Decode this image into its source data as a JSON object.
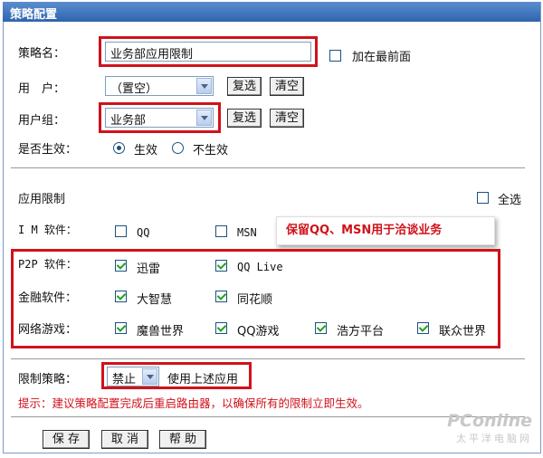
{
  "window": {
    "title": "策略配置"
  },
  "policy": {
    "name_label": "策略名：",
    "name_value": "业务部应用限制",
    "top_label": "加在最前面",
    "user_label": "用　户：",
    "user_value": "（置空）",
    "group_label": "用户组：",
    "group_value": "业务部",
    "multi_label": "复选",
    "clear_label": "清空",
    "effective_label": "是否生效：",
    "effective_on": "生效",
    "effective_off": "不生效"
  },
  "apps": {
    "section_label": "应用限制",
    "select_all": "全选",
    "note": "保留QQ、MSN用于洽谈业务",
    "rows": [
      {
        "label": "I M 软件：",
        "items": [
          {
            "label": "QQ",
            "checked": false
          },
          {
            "label": "MSN",
            "checked": false
          }
        ]
      },
      {
        "label": "P2P 软件：",
        "items": [
          {
            "label": "迅雷",
            "checked": true
          },
          {
            "label": "QQ Live",
            "checked": true
          }
        ]
      },
      {
        "label": "金融软件：",
        "items": [
          {
            "label": "大智慧",
            "checked": true
          },
          {
            "label": "同花顺",
            "checked": true
          }
        ]
      },
      {
        "label": "网络游戏：",
        "items": [
          {
            "label": "魔兽世界",
            "checked": true
          },
          {
            "label": "QQ游戏",
            "checked": true
          },
          {
            "label": "浩方平台",
            "checked": true
          },
          {
            "label": "联众世界",
            "checked": true
          }
        ]
      }
    ]
  },
  "limit": {
    "label": "限制策略：",
    "value": "禁止",
    "desc": "使用上述应用",
    "hint": "提示：建议策略配置完成后重启路由器，以确保所有的限制立即生效。"
  },
  "footer": {
    "save": "保 存",
    "cancel": "取 消",
    "help": "帮 助"
  },
  "watermark": {
    "brand": "PConline",
    "sub": "太平洋电脑网"
  },
  "colors": {
    "highlight": "#d0121b",
    "titlebar": "#2f64ad",
    "check": "#21a121"
  }
}
